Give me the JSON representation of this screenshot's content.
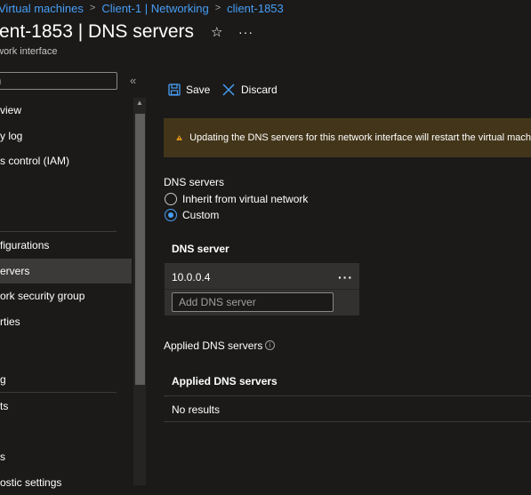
{
  "breadcrumb": {
    "items": [
      "Virtual machines",
      "Client-1 | Networking",
      "client-1853"
    ],
    "separator": ">"
  },
  "header": {
    "title": "ent-1853 | DNS servers",
    "subtitle": "work interface",
    "star_glyph": "☆",
    "more_glyph": "···"
  },
  "sidebar": {
    "search_placeholder": "h",
    "collapse_glyph": "«",
    "items": [
      {
        "label": "view"
      },
      {
        "label": "y log"
      },
      {
        "label": "s control (IAM)"
      },
      {
        "label": "figurations"
      },
      {
        "label": "ervers",
        "selected": true
      },
      {
        "label": "ork security group"
      },
      {
        "label": "rties"
      },
      {
        "label": "g"
      },
      {
        "label": "ts"
      },
      {
        "label": "s"
      },
      {
        "label": "ostic settings"
      }
    ]
  },
  "toolbar": {
    "save_label": "Save",
    "discard_label": "Discard"
  },
  "warning": {
    "text": "Updating the DNS servers for this network interface will restart the virtual mach"
  },
  "dns": {
    "section_label": "DNS servers",
    "options": [
      {
        "label": "Inherit from virtual network",
        "checked": false
      },
      {
        "label": "Custom",
        "checked": true
      }
    ],
    "column_header": "DNS server",
    "servers": [
      "10.0.0.4"
    ],
    "row_more_glyph": "···",
    "add_placeholder": "Add DNS server",
    "add_value": ""
  },
  "applied": {
    "label": "Applied DNS servers",
    "info_glyph": "i",
    "column_header": "Applied DNS servers",
    "empty_text": "No results"
  },
  "colors": {
    "background": "#1b1a19",
    "accent": "#479ef5",
    "warning_bg": "#433519",
    "warning_icon": "#f7a31b",
    "selected_nav": "#3b3a39"
  }
}
